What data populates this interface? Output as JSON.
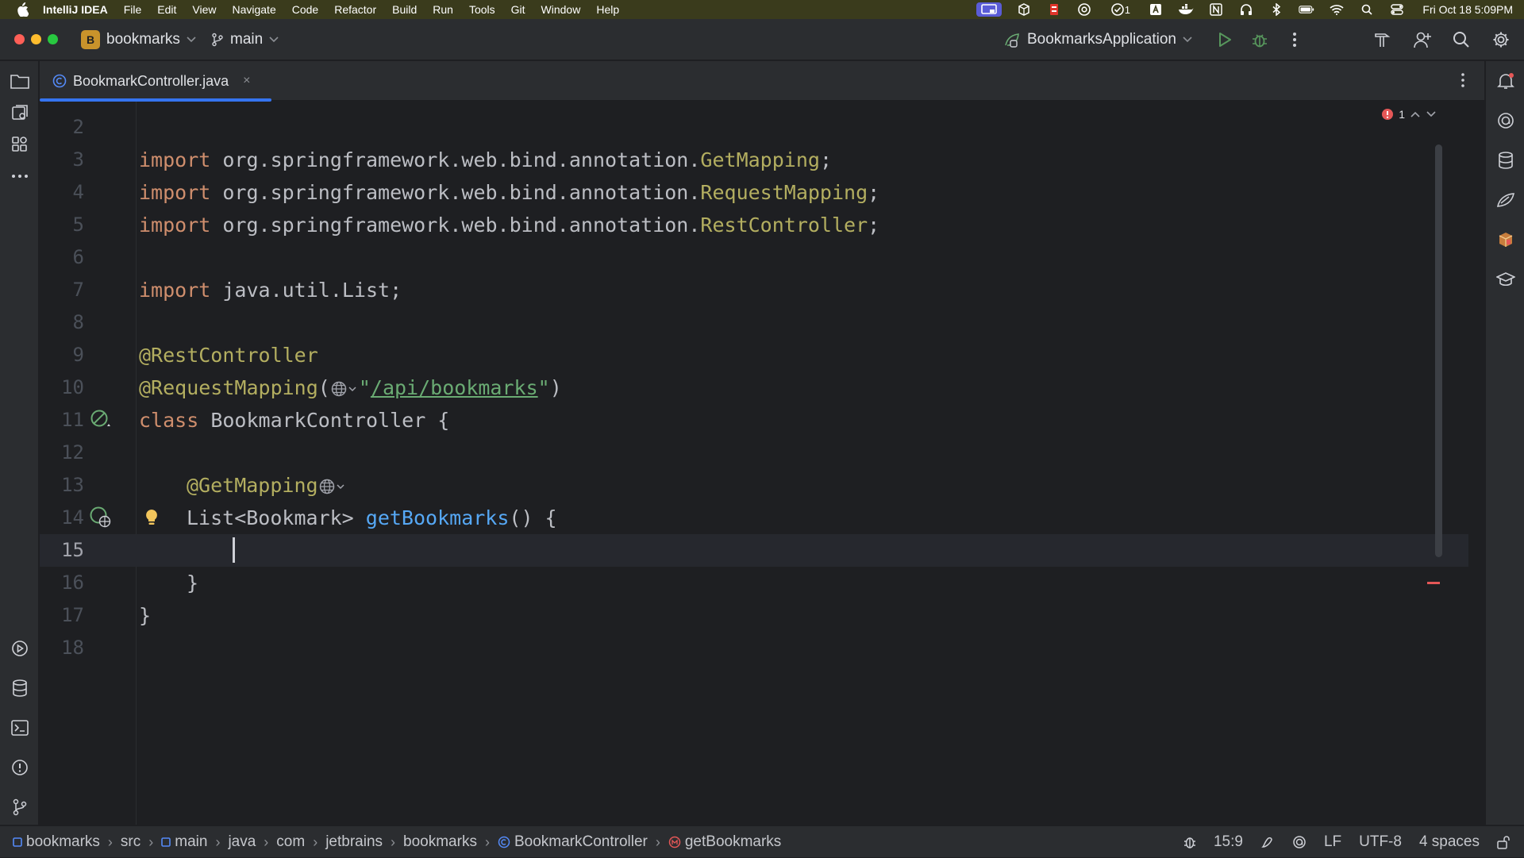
{
  "menubar": {
    "app_name": "IntelliJ IDEA",
    "items": [
      "File",
      "Edit",
      "View",
      "Navigate",
      "Code",
      "Refactor",
      "Build",
      "Run",
      "Tools",
      "Git",
      "Window",
      "Help"
    ],
    "tray_text": "1",
    "clock": "Fri Oct 18  5:09PM"
  },
  "toolbar": {
    "project_badge": "B",
    "project_name": "bookmarks",
    "branch": "main",
    "run_config": "BookmarksApplication"
  },
  "tab": {
    "title": "BookmarkController.java",
    "close": "×"
  },
  "editor": {
    "error_count": "1",
    "lines": [
      {
        "n": "2"
      },
      {
        "n": "3",
        "kw": "import",
        "pkg": " org.springframework.web.bind.annotation.",
        "name": "GetMapping",
        "end": ";"
      },
      {
        "n": "4",
        "kw": "import",
        "pkg": " org.springframework.web.bind.annotation.",
        "name": "RequestMapping",
        "end": ";"
      },
      {
        "n": "5",
        "kw": "import",
        "pkg": " org.springframework.web.bind.annotation.",
        "name": "RestController",
        "end": ";"
      },
      {
        "n": "6"
      },
      {
        "n": "7",
        "kw": "import",
        "pkg": " java.util.List;"
      },
      {
        "n": "8"
      },
      {
        "n": "9",
        "ann": "@RestController"
      },
      {
        "n": "10",
        "ann": "@RequestMapping",
        "open": "(",
        "q1": "\"",
        "url": "/api/bookmarks",
        "q2": "\"",
        "close": ")"
      },
      {
        "n": "11",
        "kw": "class",
        "rest": " BookmarkController {"
      },
      {
        "n": "12"
      },
      {
        "n": "13",
        "ann": "@GetMapping"
      },
      {
        "n": "14",
        "type": "List<Bookmark> ",
        "fn": "getBookmarks",
        "rest": "() {"
      },
      {
        "n": "15"
      },
      {
        "n": "16",
        "rest": "}"
      },
      {
        "n": "17",
        "rest": "}"
      },
      {
        "n": "18"
      }
    ]
  },
  "statusbar": {
    "breadcrumbs": [
      "bookmarks",
      "src",
      "main",
      "java",
      "com",
      "jetbrains",
      "bookmarks",
      "BookmarkController",
      "getBookmarks"
    ],
    "separator": "›",
    "position": "15:9",
    "line_ending": "LF",
    "encoding": "UTF-8",
    "indent": "4 spaces"
  },
  "colors": {
    "accent": "#3574f0",
    "keyword": "#cf8e6d",
    "annotation": "#b3ae60",
    "function": "#56a8f5",
    "string": "#6aab73",
    "error": "#e55757"
  }
}
